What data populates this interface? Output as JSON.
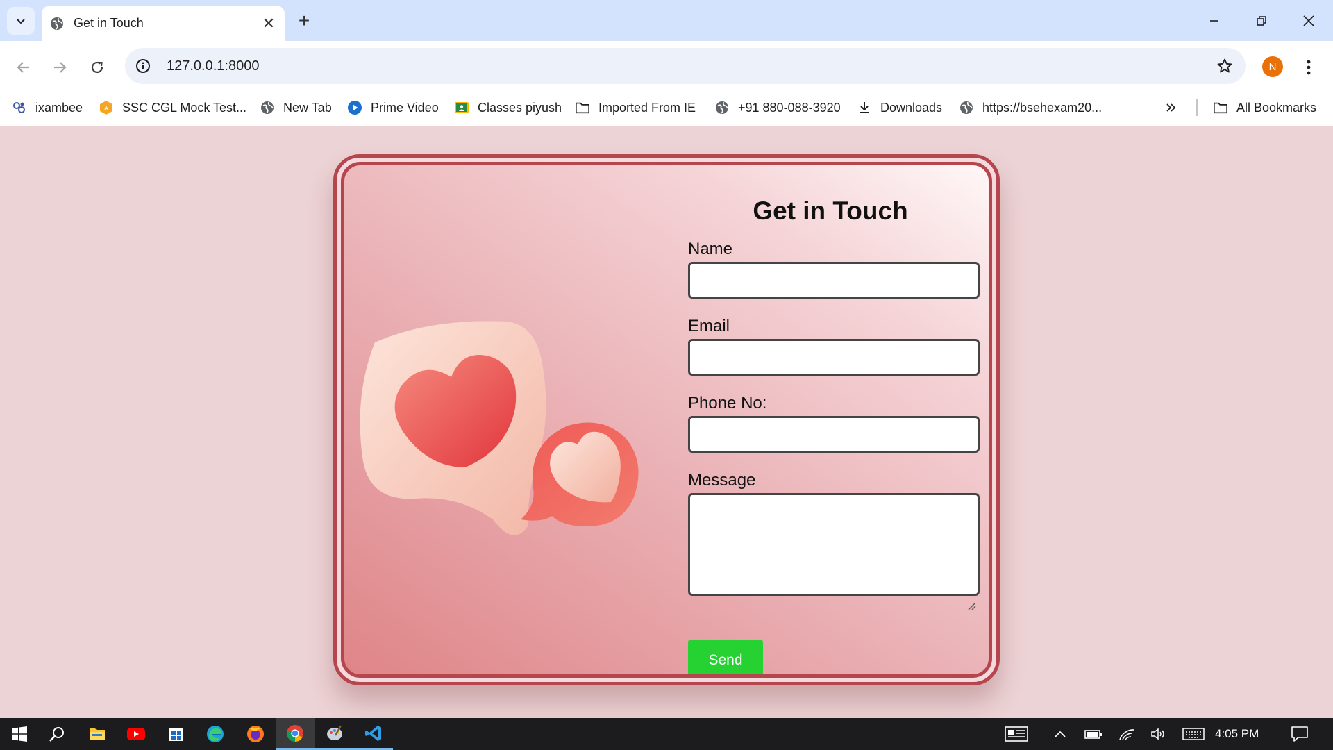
{
  "browser": {
    "tab_title": "Get in Touch",
    "url": "127.0.0.1:8000",
    "profile_initial": "N",
    "bookmarks": [
      {
        "label": "ixambee",
        "icon": "ixambee-icon"
      },
      {
        "label": "SSC CGL Mock Test...",
        "icon": "ssc-icon"
      },
      {
        "label": "New Tab",
        "icon": "globe-icon"
      },
      {
        "label": "Prime Video",
        "icon": "prime-video-icon"
      },
      {
        "label": "Classes piyush",
        "icon": "classroom-icon"
      },
      {
        "label": "Imported From IE",
        "icon": "folder-icon"
      },
      {
        "label": "+91 880-088-3920",
        "icon": "globe-icon"
      },
      {
        "label": "Downloads",
        "icon": "download-icon"
      },
      {
        "label": "https://bsehexam20...",
        "icon": "globe-icon"
      }
    ],
    "all_bookmarks_label": "All Bookmarks"
  },
  "form": {
    "title": "Get in Touch",
    "name_label": "Name",
    "name_value": "",
    "email_label": "Email",
    "email_value": "",
    "phone_label": "Phone No:",
    "phone_value": "",
    "message_label": "Message",
    "message_value": "",
    "send_label": "Send"
  },
  "colors": {
    "page_bg": "#ecd3d5",
    "card_border": "#b6464d",
    "send_button": "#26d132",
    "heart_red": "#e8474c"
  },
  "taskbar": {
    "time": "4:05 PM",
    "apps": [
      "windows-start-icon",
      "search-icon",
      "file-explorer-icon",
      "youtube-icon",
      "store-icon",
      "edge-icon",
      "firefox-icon",
      "chrome-icon",
      "paint-icon",
      "vscode-icon"
    ]
  }
}
